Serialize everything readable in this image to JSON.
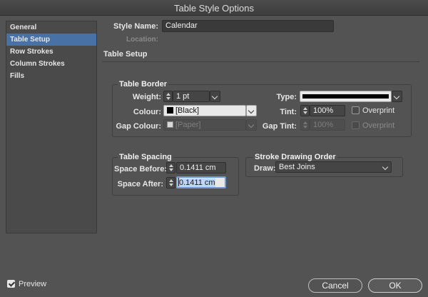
{
  "window": {
    "title": "Table Style Options"
  },
  "sidebar": {
    "items": [
      {
        "label": "General"
      },
      {
        "label": "Table Setup"
      },
      {
        "label": "Row Strokes"
      },
      {
        "label": "Column Strokes"
      },
      {
        "label": "Fills"
      }
    ],
    "selected_index": 1
  },
  "header": {
    "style_name_label": "Style Name:",
    "style_name_value": "Calendar",
    "location_label": "Location:",
    "section_title": "Table Setup"
  },
  "table_border": {
    "legend": "Table Border",
    "weight_label": "Weight:",
    "weight_value": "1 pt",
    "type_label": "Type:",
    "colour_label": "Colour:",
    "colour_value": "[Black]",
    "colour_swatch": "#000000",
    "tint_label": "Tint:",
    "tint_value": "100%",
    "overprint_label": "Overprint",
    "gap_colour_label": "Gap Colour:",
    "gap_colour_value": "[Paper]",
    "gap_colour_swatch": "#d9d9d9",
    "gap_tint_label": "Gap Tint:",
    "gap_tint_value": "100%",
    "gap_overprint_label": "Overprint"
  },
  "table_spacing": {
    "legend": "Table Spacing",
    "space_before_label": "Space Before:",
    "space_before_value": "0.1411 cm",
    "space_after_label": "Space After:",
    "space_after_value": "0.1411 cm"
  },
  "stroke_drawing_order": {
    "legend": "Stroke Drawing Order",
    "draw_label": "Draw:",
    "draw_value": "Best Joins"
  },
  "footer": {
    "preview_label": "Preview",
    "preview_checked": true,
    "cancel_label": "Cancel",
    "ok_label": "OK"
  }
}
